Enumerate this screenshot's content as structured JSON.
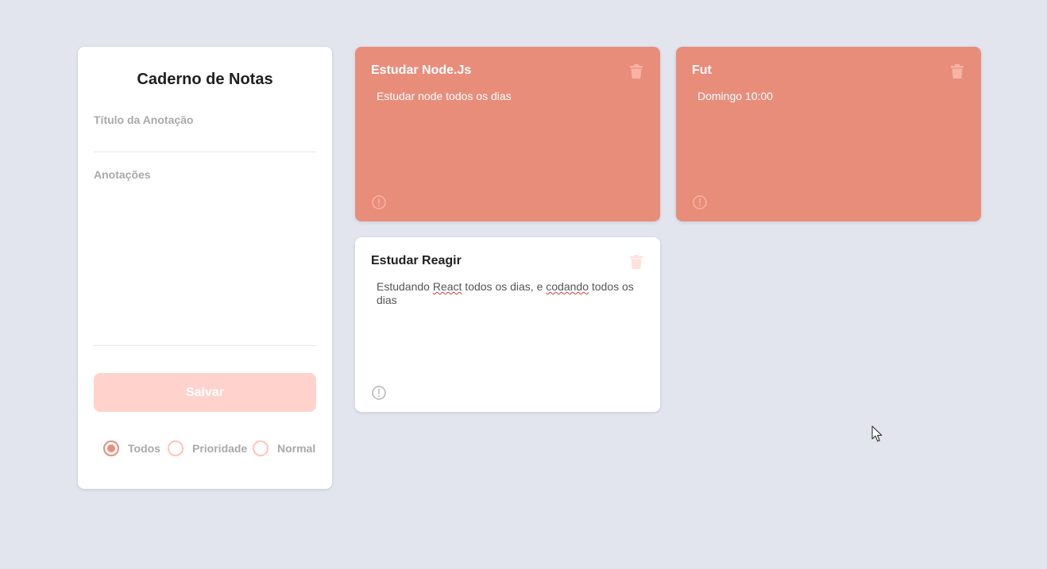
{
  "form": {
    "title": "Caderno de Notas",
    "title_placeholder": "Título da Anotação",
    "notes_placeholder": "Anotações",
    "save_label": "Salvar",
    "filters": [
      {
        "label": "Todos",
        "checked": true
      },
      {
        "label": "Prioridade",
        "checked": false
      },
      {
        "label": "Normal",
        "checked": false
      }
    ]
  },
  "notes": [
    {
      "title": "Estudar Node.Js",
      "body": "Estudar node todos os dias",
      "priority": true
    },
    {
      "title": "Fut",
      "body": "Domingo 10:00",
      "priority": true
    },
    {
      "title": "Estudar Reagir",
      "body_parts": [
        "Estudando ",
        "React",
        " todos os dias, e ",
        "codando",
        " todos os dias"
      ],
      "priority": false
    }
  ],
  "colors": {
    "background": "#e2e5ee",
    "priority_card": "#e98d7b",
    "accent": "#e88e7a",
    "save_button": "#ffd3cb"
  },
  "icons": [
    "trash-icon",
    "info-icon",
    "mouse-cursor-icon"
  ]
}
